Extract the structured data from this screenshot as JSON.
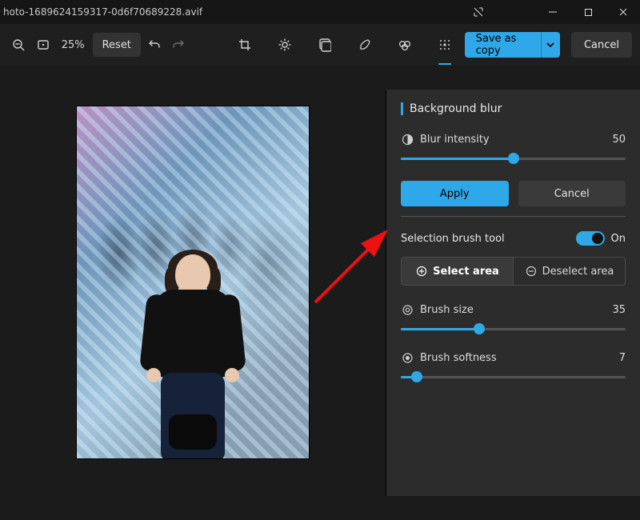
{
  "titlebar": {
    "filename": "hoto-1689624159317-0d6f70689228.avif"
  },
  "toolbar": {
    "zoom_pct": "25%",
    "reset_label": "Reset",
    "save_label": "Save as copy",
    "cancel_label": "Cancel"
  },
  "panel": {
    "title": "Background blur",
    "blur_intensity": {
      "label": "Blur intensity",
      "value": 50,
      "min": 0,
      "max": 100
    },
    "apply_label": "Apply",
    "cancel_label": "Cancel",
    "brush_tool": {
      "label": "Selection brush tool",
      "on_label": "On",
      "select_label": "Select area",
      "deselect_label": "Deselect area"
    },
    "brush_size": {
      "label": "Brush size",
      "value": 35,
      "min": 1,
      "max": 100
    },
    "brush_softness": {
      "label": "Brush softness",
      "value": 7,
      "min": 0,
      "max": 100
    }
  },
  "colors": {
    "accent": "#30a8e6"
  }
}
